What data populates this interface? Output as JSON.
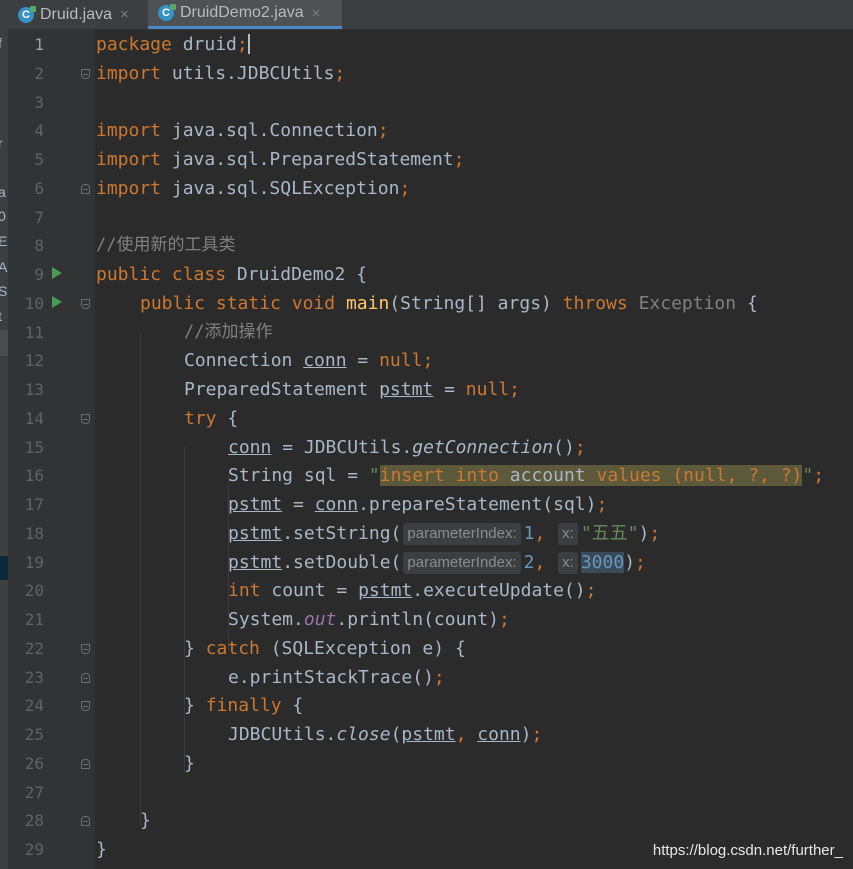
{
  "tabs": [
    {
      "label": "Druid.java",
      "icon": "java-class-icon",
      "active": false
    },
    {
      "label": "DruidDemo2.java",
      "icon": "java-class-icon",
      "active": true
    }
  ],
  "close_glyph": "×",
  "left_panel_fragments": [
    "f",
    "r",
    "a",
    "0",
    "E",
    "AS",
    "S",
    "t"
  ],
  "line_numbers": [
    "1",
    "2",
    "3",
    "4",
    "5",
    "6",
    "7",
    "8",
    "9",
    "10",
    "11",
    "12",
    "13",
    "14",
    "15",
    "16",
    "17",
    "18",
    "19",
    "20",
    "21",
    "22",
    "23",
    "24",
    "25",
    "26",
    "27",
    "28",
    "29"
  ],
  "code": {
    "l1": {
      "kw": "package",
      "rest": " druid",
      "semi": ";"
    },
    "l2": {
      "kw": "import",
      "rest": " utils.JDBCUtils",
      "semi": ";"
    },
    "l4": {
      "kw": "import",
      "rest": " java.sql.Connection",
      "semi": ";"
    },
    "l5": {
      "kw": "import",
      "rest": " java.sql.PreparedStatement",
      "semi": ";"
    },
    "l6": {
      "kw": "import",
      "rest": " java.sql.SQLException",
      "semi": ";"
    },
    "l8": {
      "comment": "//使用新的工具类"
    },
    "l9": {
      "kw1": "public",
      "kw2": "class",
      "name": "DruidDemo2",
      "brace": " {"
    },
    "l10": {
      "kw1": "public",
      "kw2": "static",
      "kw3": "void",
      "fn": "main",
      "params": "(String[] args) ",
      "kw4": "throws",
      "ex": "Exception",
      "brace": " {"
    },
    "l11": {
      "comment": "//添加操作"
    },
    "l12": {
      "type": "Connection",
      "var": "conn",
      "eq": " = ",
      "val": "null",
      "semi": ";"
    },
    "l13": {
      "type": "PreparedStatement",
      "var": "pstmt",
      "eq": " = ",
      "val": "null",
      "semi": ";"
    },
    "l14": {
      "kw": "try",
      "brace": " {"
    },
    "l15": {
      "var": "conn",
      "eq": " = JDBCUtils.",
      "call": "getConnection",
      "args": "()",
      "semi": ";"
    },
    "l16": {
      "pre": "String sql = ",
      "q": "\"",
      "sql1": "insert into ",
      "tbl": "account",
      "sql2": " values (null, ?, ?)",
      "q2": "\"",
      "semi": ";"
    },
    "l17": {
      "var": "pstmt",
      "eq": " = ",
      "var2": "conn",
      "call": ".prepareStatement(sql)",
      "semi": ";"
    },
    "l18": {
      "var": "pstmt",
      "call": ".setString(",
      "hint1": "parameterIndex:",
      "n": "1",
      "comma": ", ",
      "hint2": "x:",
      "s": "\"五五\"",
      "end": ")",
      "semi": ";"
    },
    "l19": {
      "var": "pstmt",
      "call": ".setDouble(",
      "hint1": "parameterIndex:",
      "n": "2",
      "comma": ", ",
      "hint2": "x:",
      "n2": "3000",
      "end": ")",
      "semi": ";"
    },
    "l20": {
      "kw": "int",
      "mid": " count = ",
      "var": "pstmt",
      "call": ".executeUpdate()",
      "semi": ";"
    },
    "l21": {
      "pre": "System.",
      "field": "out",
      "call": ".println(count)",
      "semi": ";"
    },
    "l22": {
      "pre": "} ",
      "kw": "catch",
      "rest": " (SQLException e) {"
    },
    "l23": {
      "pre": "e.printStackTrace()",
      "semi": ";"
    },
    "l24": {
      "pre": "} ",
      "kw": "finally",
      "brace": " {"
    },
    "l25": {
      "pre": "JDBCUtils.",
      "call": "close",
      "open": "(",
      "a1": "pstmt",
      "comma": ", ",
      "a2": "conn",
      "close": ")",
      "semi": ";"
    },
    "l26": {
      "brace": "}"
    },
    "l28": {
      "brace": "}"
    },
    "l29": {
      "brace": "}"
    }
  },
  "watermark": "https://blog.csdn.net/further_",
  "colors": {
    "keyword": "#cc7832",
    "method": "#ffc66d",
    "string": "#6a8759",
    "number": "#6897bb",
    "comment": "#808080",
    "field": "#9876aa",
    "text": "#a9b7c6",
    "background": "#2b2b2b"
  }
}
